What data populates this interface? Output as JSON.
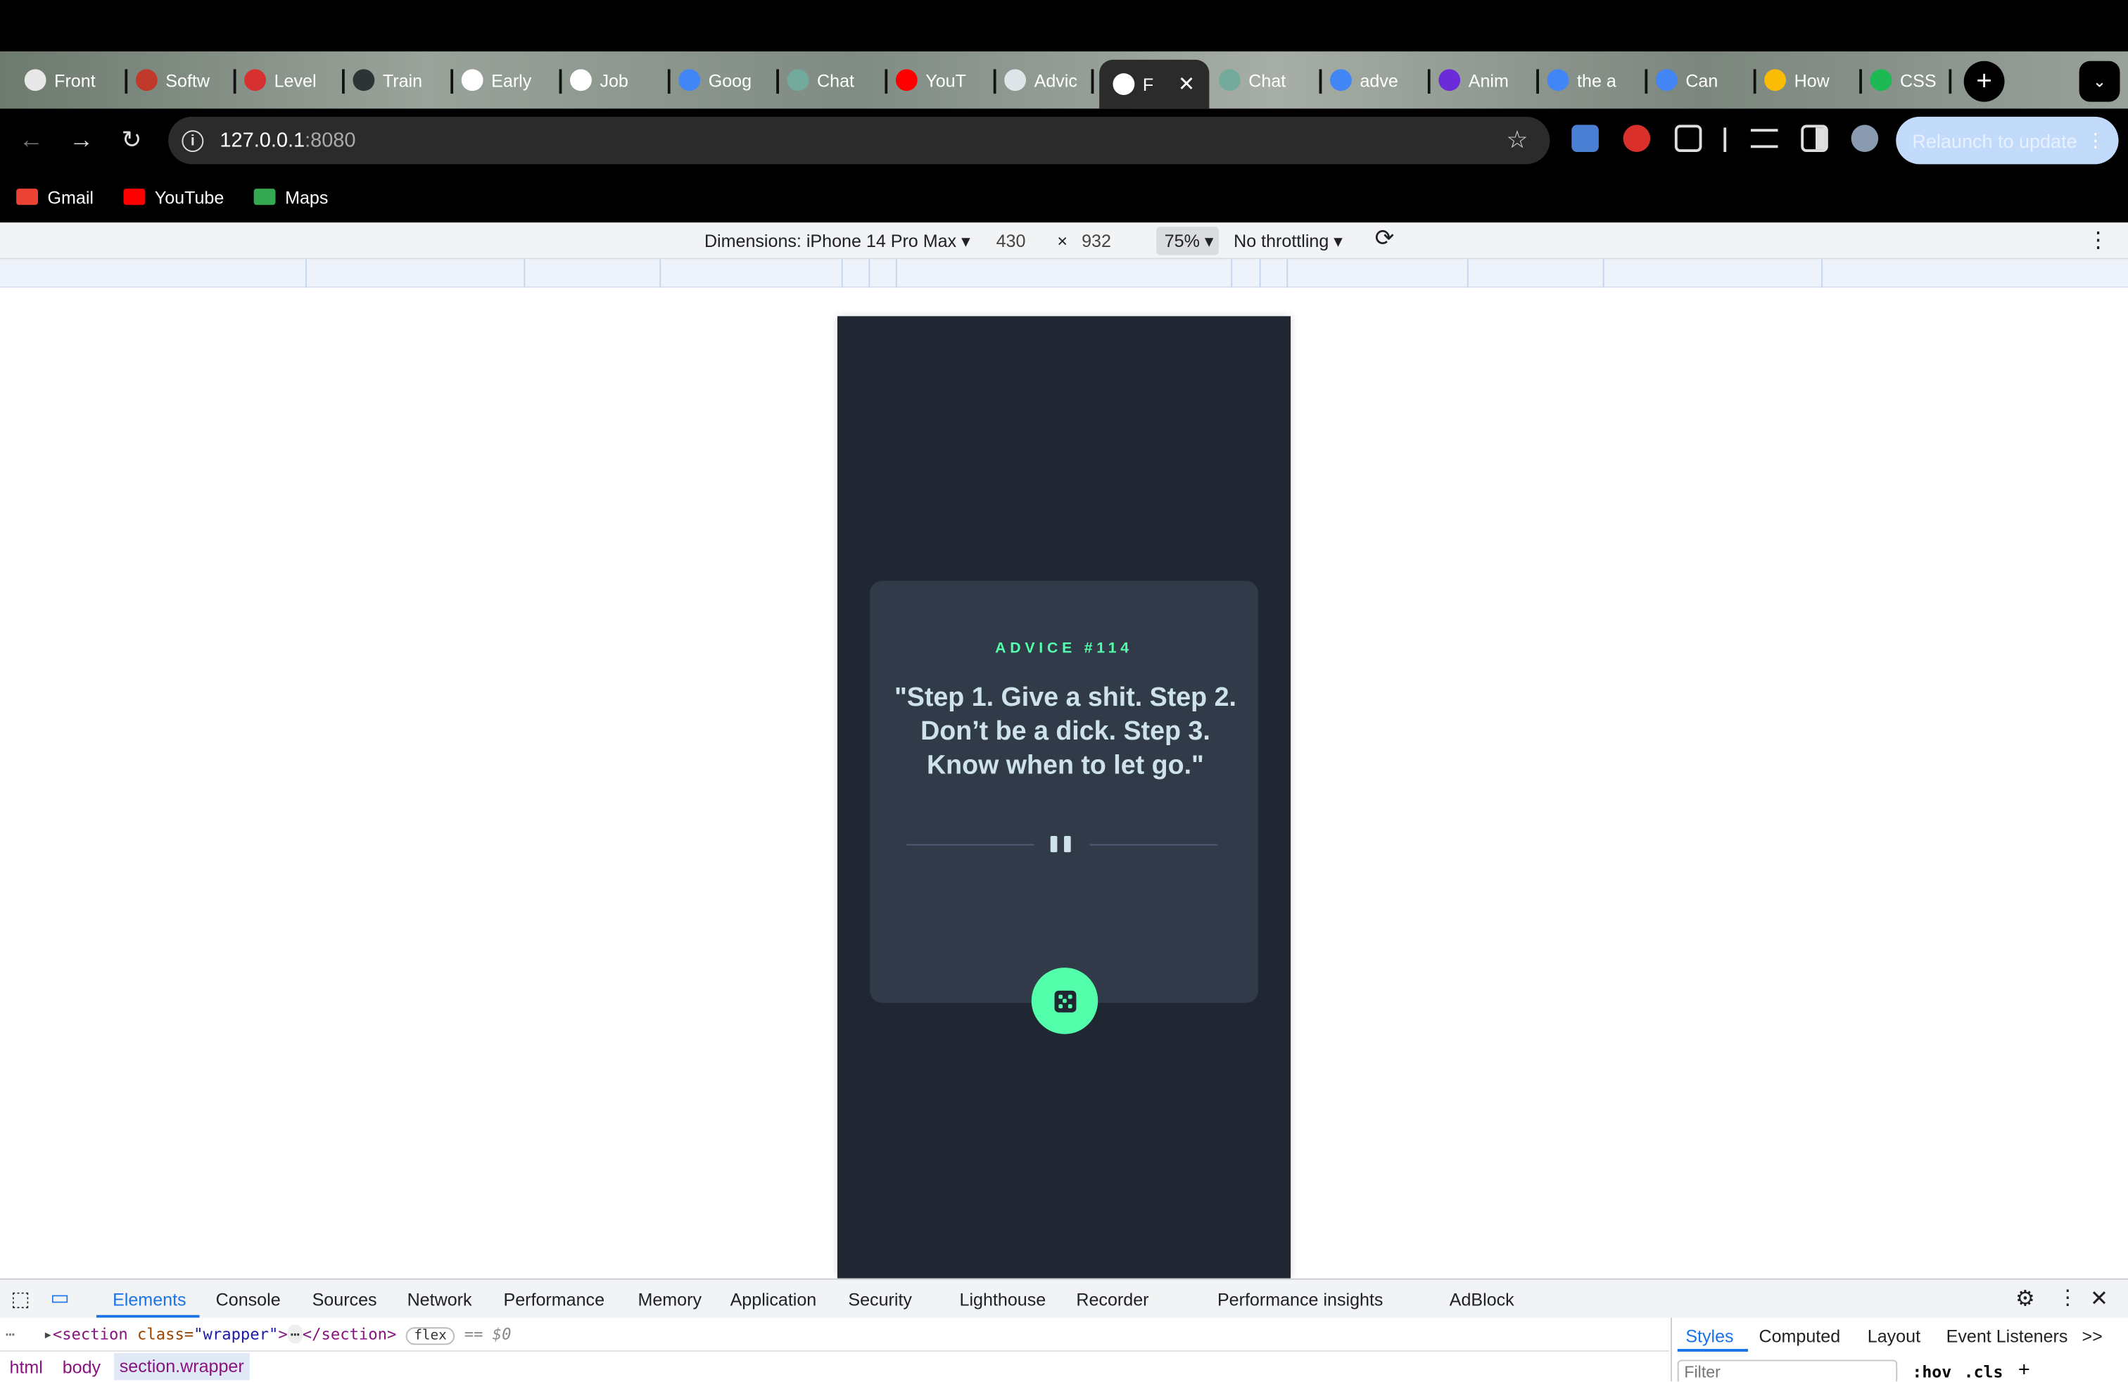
{
  "browser": {
    "tabs": [
      {
        "label": "Front",
        "favicon_color": "#e8e8e8"
      },
      {
        "label": "Softw",
        "favicon_color": "#c0392b"
      },
      {
        "label": "Level",
        "favicon_color": "#d63031"
      },
      {
        "label": "Train",
        "favicon_color": "#2d3436"
      },
      {
        "label": "Early",
        "favicon_color": "#ffffff"
      },
      {
        "label": "Job",
        "favicon_color": "#ffffff"
      },
      {
        "label": "Goog",
        "favicon_color": "#4285f4"
      },
      {
        "label": "Chat",
        "favicon_color": "#74aa9c"
      },
      {
        "label": "YouT",
        "favicon_color": "#ff0000"
      },
      {
        "label": "Advic",
        "favicon_color": "#dfe6e9"
      },
      {
        "label": "F",
        "favicon_color": "#ffffff",
        "active": true
      },
      {
        "label": "Chat",
        "favicon_color": "#74aa9c"
      },
      {
        "label": "adve",
        "favicon_color": "#4285f4"
      },
      {
        "label": "Anim",
        "favicon_color": "#6c2bd9"
      },
      {
        "label": "the a",
        "favicon_color": "#4285f4"
      },
      {
        "label": "Can",
        "favicon_color": "#4285f4"
      },
      {
        "label": "How",
        "favicon_color": "#fbbc05"
      },
      {
        "label": "CSS",
        "favicon_color": "#1db954"
      }
    ],
    "new_tab_label": "+",
    "url_host": "127.0.0.1",
    "url_port": ":8080",
    "relaunch_label": "Relaunch to update",
    "bookmarks": [
      {
        "label": "Gmail",
        "icon_color": "#ea4335"
      },
      {
        "label": "YouTube",
        "icon_color": "#ff0000"
      },
      {
        "label": "Maps",
        "icon_color": "#34a853"
      }
    ]
  },
  "device_toolbar": {
    "dimensions_label": "Dimensions: iPhone 14 Pro Max",
    "width": "430",
    "times": "×",
    "height": "932",
    "zoom": "75%",
    "throttling": "No throttling"
  },
  "app": {
    "advice_id": "ADVICE #114",
    "quote": "\"Step 1. Give a shit. Step 2. Don’t be a dick. Step 3. Know when to let go.\"",
    "colors": {
      "background": "#202733",
      "card": "#313a48",
      "accent": "#53ffaa",
      "text": "#cee3e9"
    }
  },
  "devtools": {
    "tabs": [
      "Elements",
      "Console",
      "Sources",
      "Network",
      "Performance",
      "Memory",
      "Application",
      "Security",
      "Lighthouse",
      "Recorder",
      "Performance insights",
      "AdBlock"
    ],
    "elements_line": {
      "open_tag": "<section",
      "attr_name": " class=",
      "attr_value": "\"wrapper\"",
      "close_open": ">",
      "ellipsis": "⋯",
      "close_tag": "</section>",
      "badge": "flex",
      "eq": "== $0"
    },
    "breadcrumbs": [
      "html",
      "body",
      "section.wrapper"
    ],
    "side_tabs": [
      "Styles",
      "Computed",
      "Layout",
      "Event Listeners"
    ],
    "more": ">>",
    "filter_placeholder": "Filter",
    "hov": ":hov",
    "cls": ".cls"
  }
}
